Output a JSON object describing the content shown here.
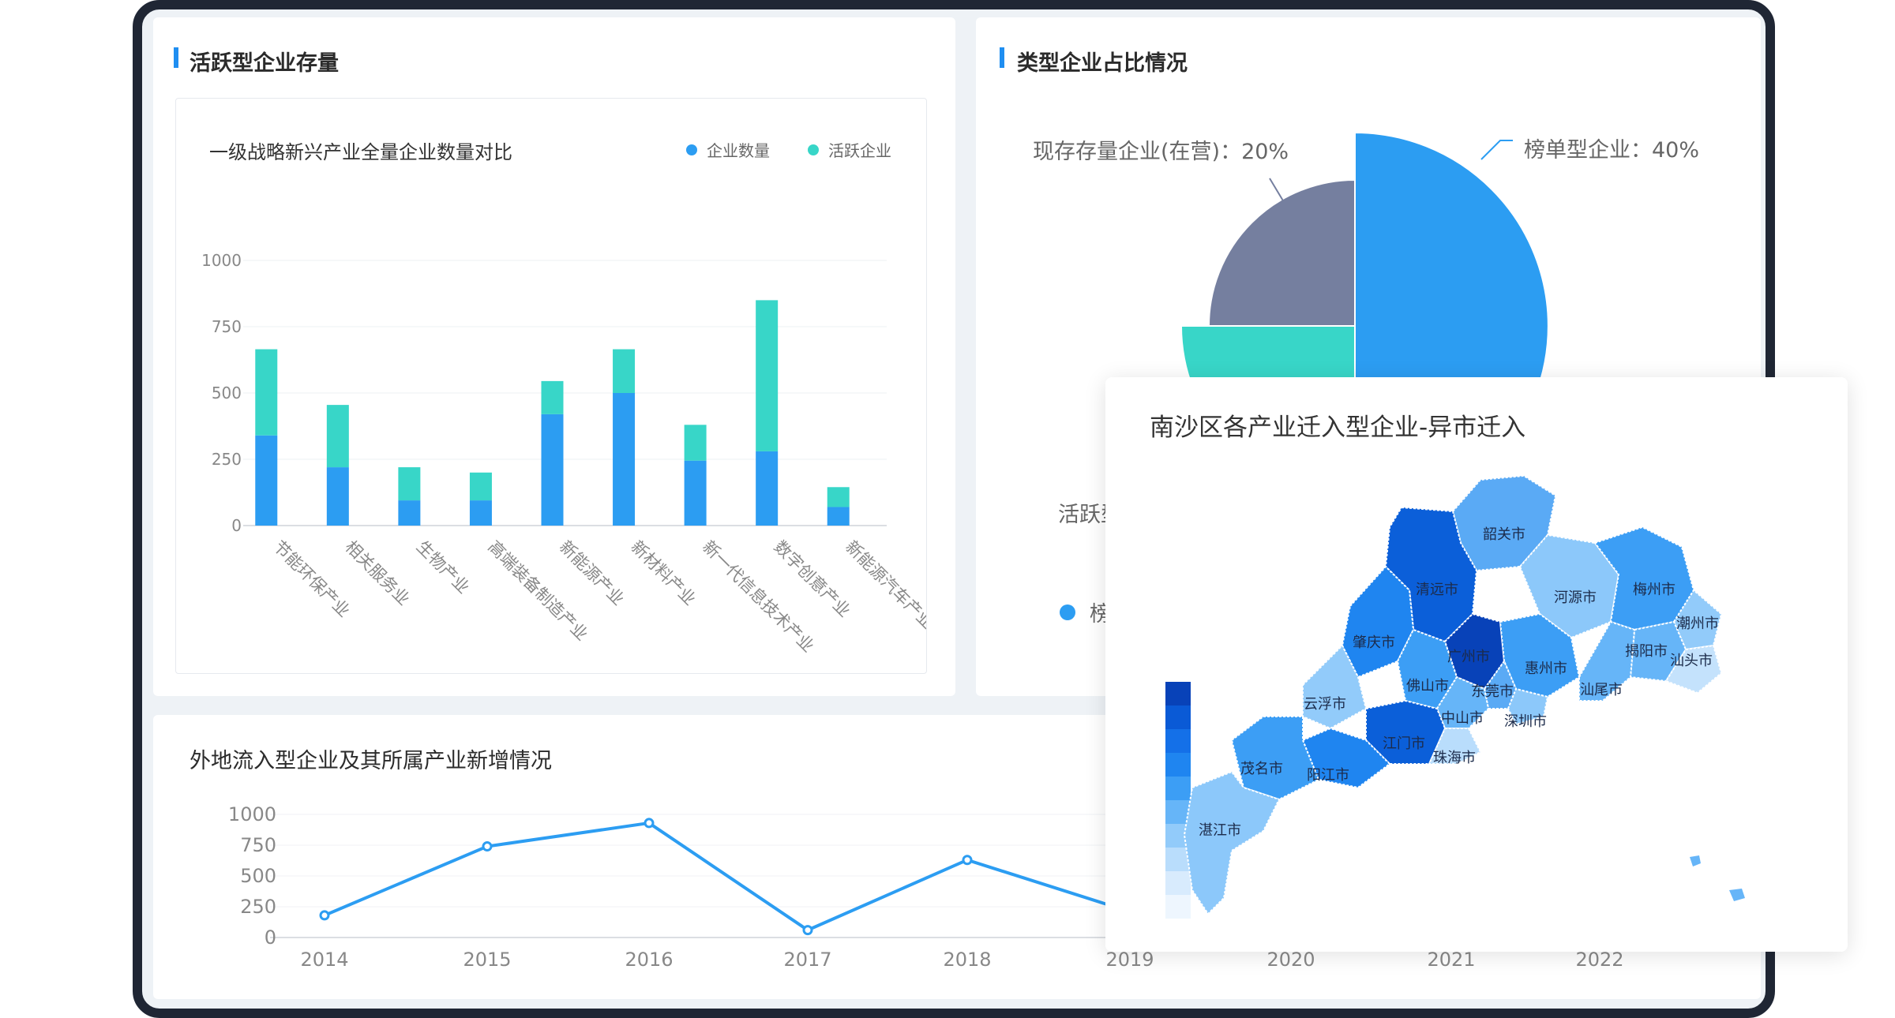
{
  "panels": {
    "active": {
      "title": "活跃型企业存量"
    },
    "type_share": {
      "title": "类型企业占比情况"
    },
    "inflow": {
      "title": "外地流入型企业及其所属产业新增情况"
    },
    "map": {
      "title": "南沙区各产业迁入型企业-异市迁入"
    }
  },
  "bar_chart": {
    "title": "一级战略新兴产业全量企业数量对比",
    "legend": [
      {
        "label": "企业数量",
        "color": "#2c9df2"
      },
      {
        "label": "活跃企业",
        "color": "#38d6c8"
      }
    ]
  },
  "pie_legend_partial": {
    "label_fragment": "活跃型",
    "legend_fragment": "榜"
  },
  "map": {
    "cities": [
      "韶关市",
      "清远市",
      "河源市",
      "梅州市",
      "潮州市",
      "揭阳市",
      "汕头市",
      "肇庆市",
      "广州市",
      "惠州市",
      "云浮市",
      "佛山市",
      "东莞市",
      "汕尾市",
      "中山市",
      "深圳市",
      "茂名市",
      "阳江市",
      "江门市",
      "珠海市",
      "湛江市"
    ]
  },
  "chart_data": [
    {
      "type": "bar",
      "title": "一级战略新兴产业全量企业数量对比",
      "categories": [
        "节能环保产业",
        "相关服务业",
        "生物产业",
        "高端装备制造产业",
        "新能源产业",
        "新材料产业",
        "新一代信息技术产业",
        "数字创意产业",
        "新能源汽车产业"
      ],
      "series": [
        {
          "name": "企业数量",
          "values": [
            340,
            220,
            95,
            95,
            420,
            500,
            245,
            280,
            70
          ],
          "color": "#2c9df2"
        },
        {
          "name": "活跃企业",
          "values": [
            325,
            235,
            125,
            105,
            125,
            165,
            135,
            570,
            75
          ],
          "color": "#38d6c8"
        }
      ],
      "stacked": true,
      "yticks": [
        "1000",
        "750",
        "500",
        "250",
        "0"
      ],
      "ylim": [
        0,
        1000
      ],
      "grid": true,
      "legend": "top-right"
    },
    {
      "type": "pie",
      "subtype": "rose",
      "slices": [
        {
          "label": "榜单型企业：40%",
          "value": 40,
          "color": "#2c9df2"
        },
        {
          "label": "",
          "value": 20,
          "color": "#38d6c8"
        },
        {
          "label": "现存存量企业(在营)：20%",
          "value": 20,
          "color": "#757f9f"
        }
      ]
    },
    {
      "type": "line",
      "title": "外地流入型企业及其所属产业新增情况",
      "x": [
        "2014",
        "2015",
        "2016",
        "2017",
        "2018",
        "2019",
        "2020",
        "2021",
        "2022"
      ],
      "y_visible": [
        180,
        740,
        930,
        60,
        630,
        210
      ],
      "yticks": [
        "1000",
        "750",
        "500",
        "250",
        "0"
      ],
      "ylim": [
        0,
        1000
      ],
      "color": "#2c9df2"
    }
  ]
}
